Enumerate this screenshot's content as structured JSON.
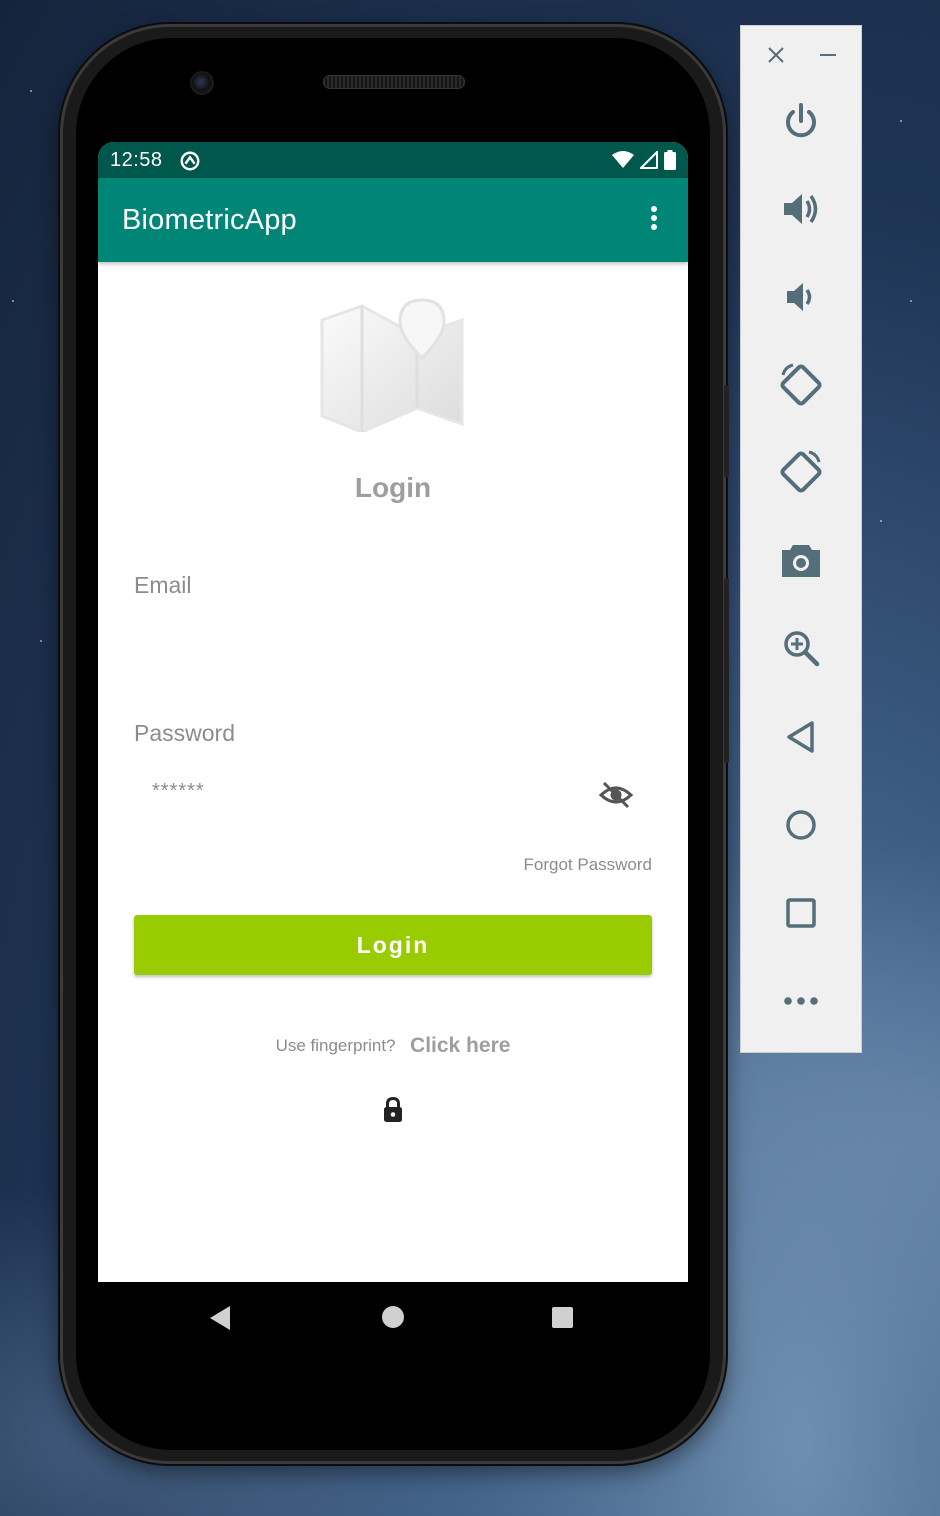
{
  "status_bar": {
    "time": "12:58",
    "icons": [
      "sync-icon",
      "wifi-icon",
      "signal-icon",
      "battery-icon"
    ]
  },
  "app_bar": {
    "title": "BiometricApp",
    "menu_icon": "more-vert-icon"
  },
  "colors": {
    "status_bar": "#00574b",
    "app_bar": "#008577",
    "login_button": "#99cc00",
    "panel_icon": "#546e7a"
  },
  "login": {
    "heading": "Login",
    "email_label": "Email",
    "email_value": "",
    "password_label": "Password",
    "password_value": "******",
    "forgot_password": "Forgot Password",
    "login_button": "Login",
    "fingerprint_question": "Use fingerprint?",
    "fingerprint_link": "Click here"
  },
  "nav_bar": {
    "buttons": [
      "back-icon",
      "home-icon",
      "recents-icon"
    ]
  },
  "emulator_panel": {
    "window_controls": [
      "close-icon",
      "minimize-icon"
    ],
    "buttons": [
      "power-icon",
      "volume-up-icon",
      "volume-down-icon",
      "rotate-left-icon",
      "rotate-right-icon",
      "camera-icon",
      "zoom-icon",
      "back-icon",
      "home-icon",
      "overview-icon",
      "more-icon"
    ]
  }
}
